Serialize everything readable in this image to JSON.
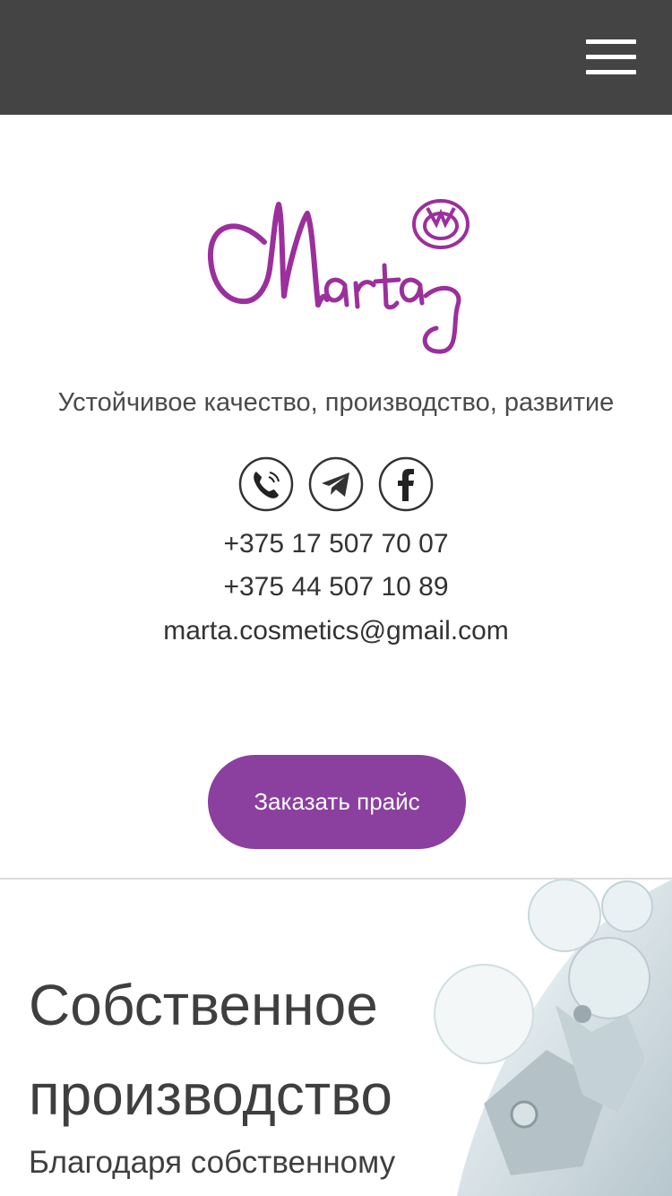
{
  "header": {
    "menu_icon": "hamburger-menu-icon",
    "background": "#444444"
  },
  "brand": {
    "logo_text": "Marta",
    "logo_color": "#9b2f9c"
  },
  "tagline": "Устойчивое качество, производство, развитие",
  "socials": [
    {
      "name": "viber",
      "icon": "phone-icon"
    },
    {
      "name": "telegram",
      "icon": "telegram-icon"
    },
    {
      "name": "facebook",
      "icon": "facebook-icon"
    }
  ],
  "contacts": {
    "phone1": "+375 17 507 70 07",
    "phone2": "+375 44 507 10 89",
    "email": "marta.cosmetics@gmail.com"
  },
  "cta": {
    "label": "Заказать прайс",
    "color": "#8b3f9f"
  },
  "section": {
    "title": "Собственное производство",
    "text": "Благодаря собственному"
  }
}
